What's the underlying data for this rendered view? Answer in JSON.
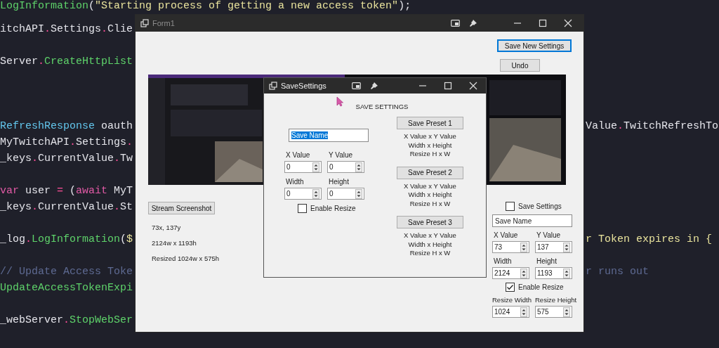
{
  "editor": {
    "lines": [
      {
        "kind": "code",
        "left": [
          {
            "kind": "method",
            "text": "LogInformation"
          },
          {
            "kind": "ident",
            "text": "("
          },
          {
            "kind": "string",
            "text": "\"Starting process of getting a new access token\""
          },
          {
            "kind": "ident",
            "text": ");"
          }
        ]
      },
      {
        "kind": "blank"
      },
      {
        "kind": "code",
        "left": [
          {
            "kind": "ident",
            "text": "itchAPI"
          },
          {
            "kind": "op",
            "text": "."
          },
          {
            "kind": "ident",
            "text": "Settings"
          },
          {
            "kind": "op",
            "text": "."
          },
          {
            "kind": "ident",
            "text": "Clie"
          }
        ]
      },
      {
        "kind": "blank"
      },
      {
        "kind": "code",
        "left": [
          {
            "kind": "ident",
            "text": "Server"
          },
          {
            "kind": "op",
            "text": "."
          },
          {
            "kind": "method",
            "text": "CreateHttpList"
          }
        ]
      },
      {
        "kind": "blank"
      },
      {
        "kind": "blank"
      },
      {
        "kind": "blank"
      },
      {
        "kind": "code",
        "left": [
          {
            "kind": "type",
            "text": "RefreshResponse"
          },
          {
            "kind": "ident",
            "text": " oauth"
          }
        ],
        "right": [
          {
            "kind": "ident",
            "text": "Value"
          },
          {
            "kind": "op",
            "text": "."
          },
          {
            "kind": "ident",
            "text": "TwitchRefreshTo"
          }
        ]
      },
      {
        "kind": "code",
        "left": [
          {
            "kind": "ident",
            "text": "MyTwitchAPI"
          },
          {
            "kind": "op",
            "text": "."
          },
          {
            "kind": "ident",
            "text": "Settings"
          },
          {
            "kind": "op",
            "text": "."
          }
        ]
      },
      {
        "kind": "code",
        "left": [
          {
            "kind": "ident",
            "text": "_keys"
          },
          {
            "kind": "op",
            "text": "."
          },
          {
            "kind": "ident",
            "text": "CurrentValue"
          },
          {
            "kind": "op",
            "text": "."
          },
          {
            "kind": "ident",
            "text": "Tw"
          }
        ]
      },
      {
        "kind": "blank"
      },
      {
        "kind": "code",
        "left": [
          {
            "kind": "keyword",
            "text": "var"
          },
          {
            "kind": "ident",
            "text": " user "
          },
          {
            "kind": "op",
            "text": "="
          },
          {
            "kind": "ident",
            "text": " ("
          },
          {
            "kind": "keyword",
            "text": "await"
          },
          {
            "kind": "ident",
            "text": " MyT"
          }
        ]
      },
      {
        "kind": "code",
        "left": [
          {
            "kind": "ident",
            "text": "_keys"
          },
          {
            "kind": "op",
            "text": "."
          },
          {
            "kind": "ident",
            "text": "CurrentValue"
          },
          {
            "kind": "op",
            "text": "."
          },
          {
            "kind": "ident",
            "text": "St"
          }
        ]
      },
      {
        "kind": "blank"
      },
      {
        "kind": "code",
        "left": [
          {
            "kind": "ident",
            "text": "_log"
          },
          {
            "kind": "op",
            "text": "."
          },
          {
            "kind": "method",
            "text": "LogInformation"
          },
          {
            "kind": "ident",
            "text": "("
          },
          {
            "kind": "string",
            "text": "$"
          }
        ],
        "right": [
          {
            "kind": "string",
            "text": "r Token expires in {"
          }
        ]
      },
      {
        "kind": "blank"
      },
      {
        "kind": "code",
        "left": [
          {
            "kind": "comment",
            "text": "// Update Access Toke"
          }
        ],
        "right": [
          {
            "kind": "comment",
            "text": "r runs out"
          }
        ]
      },
      {
        "kind": "code",
        "left": [
          {
            "kind": "method",
            "text": "UpdateAccessTokenExpi"
          }
        ]
      },
      {
        "kind": "blank"
      },
      {
        "kind": "code",
        "left": [
          {
            "kind": "ident",
            "text": "_webServer"
          },
          {
            "kind": "op",
            "text": "."
          },
          {
            "kind": "method",
            "text": "StopWebSer"
          }
        ]
      }
    ]
  },
  "form1": {
    "title": "Form1",
    "active": false,
    "save_new_settings": {
      "label": "Save New Settings",
      "focused": true
    },
    "undo": {
      "label": "Undo",
      "focused": false
    },
    "stream_screenshot": {
      "label": "Stream Screenshot",
      "focused": false
    },
    "info_lines": [
      "73x, 137y",
      "2124w x 1193h",
      "Resized 1024w x 575h"
    ],
    "panel": [
      {
        "kind": "checkbox",
        "label": "Save Settings",
        "checked": false
      },
      {
        "kind": "textbox",
        "value": "Save Name",
        "text_selected": false
      },
      {
        "kind": "spinners",
        "fields": [
          {
            "label": "X Value",
            "value": "73"
          },
          {
            "label": "Y Value",
            "value": "137"
          }
        ]
      },
      {
        "kind": "spinners",
        "fields": [
          {
            "label": "Width",
            "value": "2124"
          },
          {
            "label": "Height",
            "value": "1193"
          }
        ]
      },
      {
        "kind": "checkbox",
        "label": "Enable Resize",
        "checked": true
      },
      {
        "kind": "spinners",
        "fields": [
          {
            "label": "Resize Width",
            "value": "1024"
          },
          {
            "label": "Resize Height",
            "value": "575"
          }
        ]
      }
    ]
  },
  "save_settings": {
    "title": "SaveSettings",
    "active": true,
    "heading": "SAVE SETTINGS",
    "left": [
      {
        "kind": "textbox",
        "value": "Save Name",
        "text_selected": true
      },
      {
        "kind": "spinners",
        "fields": [
          {
            "label": "X Value",
            "value": "0"
          },
          {
            "label": "Y Value",
            "value": "0"
          }
        ]
      },
      {
        "kind": "spinners",
        "fields": [
          {
            "label": "Width",
            "value": "0"
          },
          {
            "label": "Height",
            "value": "0"
          }
        ]
      },
      {
        "kind": "checkbox",
        "label": "Enable Resize",
        "checked": false
      }
    ],
    "presets": [
      {
        "button": "Save Preset 1",
        "lines": [
          "X Value x Y Value",
          "Width x Height",
          "Resize H x W"
        ]
      },
      {
        "button": "Save Preset 2",
        "lines": [
          "X Value x Y Value",
          "Width x Height",
          "Resize H x W"
        ]
      },
      {
        "button": "Save Preset 3",
        "lines": [
          "X Value x Y Value",
          "Width x Height",
          "Resize H x W"
        ]
      }
    ]
  }
}
